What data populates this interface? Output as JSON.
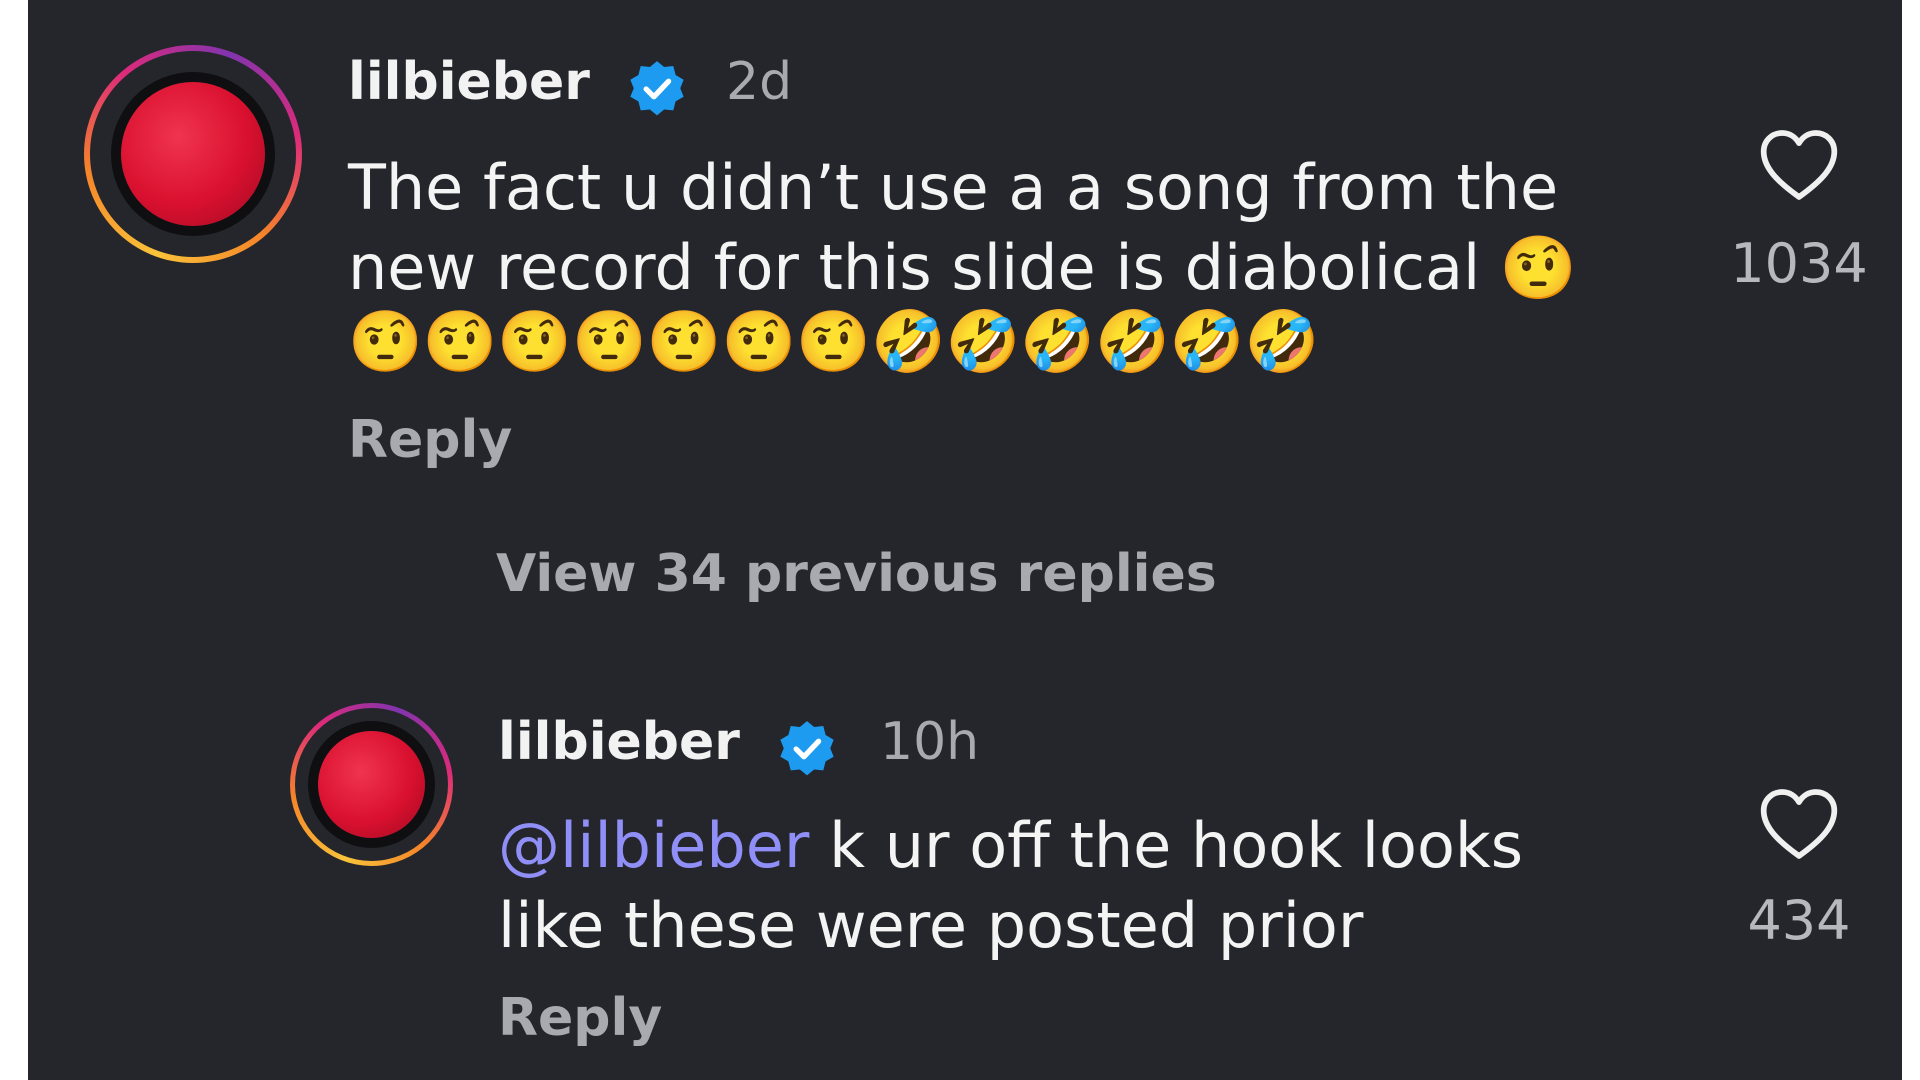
{
  "comments": [
    {
      "username": "lilbieber",
      "time": "2d",
      "text": "The fact u didn’t use a a song from the new record for this slide is diabolical 🤨",
      "emojis": "🤨🤨🤨🤨🤨🤨🤨🤣🤣🤣🤣🤣🤣",
      "reply_label": "Reply",
      "like_count": "1034"
    },
    {
      "username": "lilbieber",
      "time": "10h",
      "mention": "@lilbieber",
      "text": " k ur off the hook looks like these were posted prior",
      "reply_label": "Reply",
      "like_count": "434"
    }
  ],
  "view_replies_label": "View 34 previous replies",
  "colors": {
    "background": "#25262b",
    "mention": "#8f8ff7",
    "verified": "#1d9bf0",
    "secondary_text": "#a9aab0"
  },
  "icons": [
    "verified-badge-icon",
    "heart-icon"
  ]
}
